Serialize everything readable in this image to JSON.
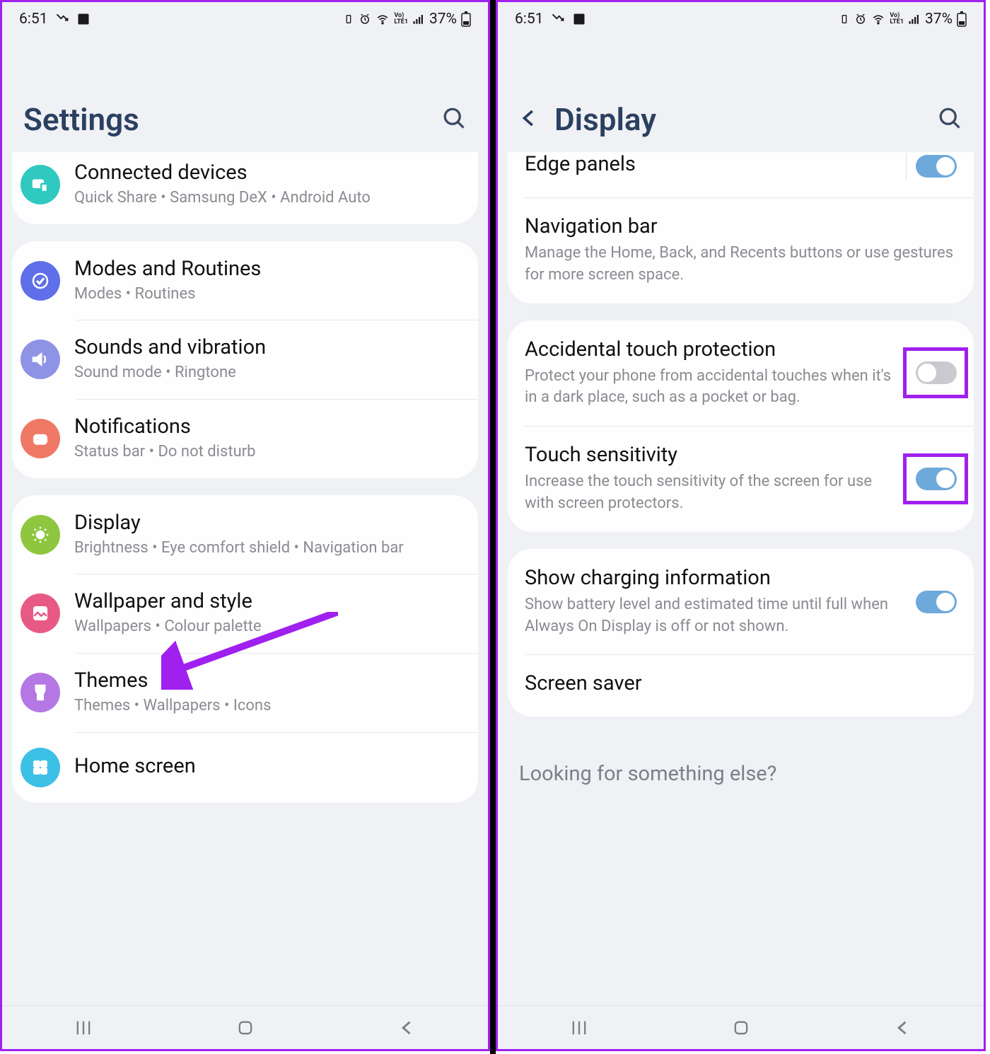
{
  "status": {
    "time": "6:51",
    "battery": "37%"
  },
  "left": {
    "title": "Settings",
    "groups": [
      {
        "peekTop": true,
        "items": [
          {
            "icon": "connected",
            "color": "#2fc9c0",
            "title": "Connected devices",
            "sub": "Quick Share  •  Samsung DeX  •  Android Auto"
          }
        ]
      },
      {
        "items": [
          {
            "icon": "modes",
            "color": "#5e6fe9",
            "title": "Modes and Routines",
            "sub": "Modes  •  Routines"
          },
          {
            "icon": "sound",
            "color": "#8f93e6",
            "title": "Sounds and vibration",
            "sub": "Sound mode  •  Ringtone"
          },
          {
            "icon": "notif",
            "color": "#f07866",
            "title": "Notifications",
            "sub": "Status bar  •  Do not disturb"
          }
        ]
      },
      {
        "items": [
          {
            "icon": "display",
            "color": "#8ec63f",
            "title": "Display",
            "sub": "Brightness  •  Eye comfort shield  •  Navigation bar"
          },
          {
            "icon": "wallpaper",
            "color": "#e85a86",
            "title": "Wallpaper and style",
            "sub": "Wallpapers  •  Colour palette"
          },
          {
            "icon": "themes",
            "color": "#b477e3",
            "title": "Themes",
            "sub": "Themes  •  Wallpapers  •  Icons"
          },
          {
            "icon": "home",
            "color": "#3dc0e6",
            "title": "Home screen",
            "sub": ""
          }
        ]
      }
    ]
  },
  "right": {
    "title": "Display",
    "groups": [
      {
        "peekTop": true,
        "items": [
          {
            "title": "Edge panels",
            "sub": "",
            "toggle": "on",
            "sep": true
          },
          {
            "title": "Navigation bar",
            "sub": "Manage the Home, Back, and Recents buttons or use gestures for more screen space."
          }
        ]
      },
      {
        "items": [
          {
            "title": "Accidental touch protection",
            "sub": "Protect your phone from accidental touches when it's in a dark place, such as a pocket or bag.",
            "toggle": "off",
            "highlight": true
          },
          {
            "title": "Touch sensitivity",
            "sub": "Increase the touch sensitivity of the screen for use with screen protectors.",
            "toggle": "on",
            "highlight": true
          }
        ]
      },
      {
        "items": [
          {
            "title": "Show charging information",
            "sub": "Show battery level and estimated time until full when Always On Display is off or not shown.",
            "toggle": "on"
          },
          {
            "title": "Screen saver",
            "sub": ""
          }
        ]
      }
    ],
    "footer": "Looking for something else?"
  }
}
